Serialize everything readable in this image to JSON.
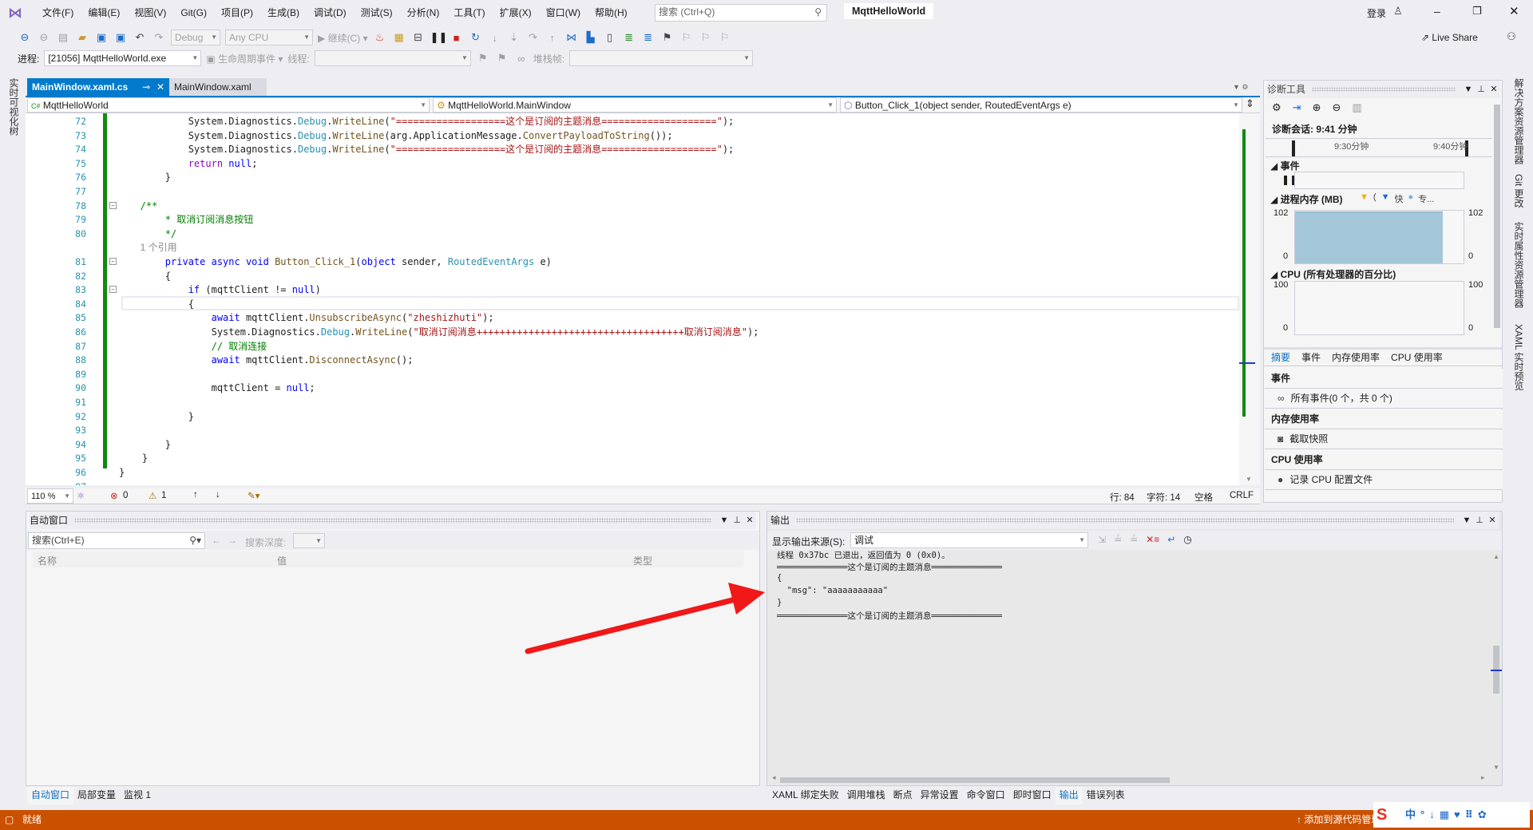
{
  "titlebar": {
    "menu": [
      "文件(F)",
      "编辑(E)",
      "视图(V)",
      "Git(G)",
      "项目(P)",
      "生成(B)",
      "调试(D)",
      "测试(S)",
      "分析(N)",
      "工具(T)",
      "扩展(X)",
      "窗口(W)",
      "帮助(H)"
    ],
    "search_placeholder": "搜索 (Ctrl+Q)",
    "solution_name": "MqttHelloWorld",
    "sign_in": "登录",
    "live_share": "Live Share"
  },
  "toolbar": {
    "config": "Debug",
    "platform": "Any CPU",
    "continue": "继续(C)",
    "process_label": "进程:",
    "process_value": "[21056] MqttHelloWorld.exe",
    "lifecycle": "生命周期事件",
    "thread_label": "线程:",
    "stack_label": "堆栈帧:"
  },
  "left_strip": {
    "label": "实时可视化树"
  },
  "right_strip": {
    "items": [
      "解决方案资源管理器",
      "Git 更改",
      "实时属性资源管理器",
      "XAML 实时预览"
    ]
  },
  "editor": {
    "tabs": [
      {
        "label": "MainWindow.xaml.cs",
        "active": true
      },
      {
        "label": "MainWindow.xaml",
        "active": false
      }
    ],
    "nav": {
      "project": "MqttHelloWorld",
      "type": "MqttHelloWorld.MainWindow",
      "member": "Button_Click_1(object sender, RoutedEventArgs e)"
    },
    "lines": [
      {
        "n": "72",
        "t": [
          [
            "n",
            "            System.Diagnostics."
          ],
          [
            "t",
            "Debug"
          ],
          [
            "n",
            "."
          ],
          [
            "m",
            "WriteLine"
          ],
          [
            "n",
            "("
          ],
          [
            "s",
            "\"===================这个是订阅的主题消息====================\""
          ],
          [
            "n",
            ");"
          ]
        ]
      },
      {
        "n": "73",
        "t": [
          [
            "n",
            "            System.Diagnostics."
          ],
          [
            "t",
            "Debug"
          ],
          [
            "n",
            "."
          ],
          [
            "m",
            "WriteLine"
          ],
          [
            "n",
            "(arg.ApplicationMessage."
          ],
          [
            "m",
            "ConvertPayloadToString"
          ],
          [
            "n",
            "());"
          ]
        ]
      },
      {
        "n": "74",
        "t": [
          [
            "n",
            "            System.Diagnostics."
          ],
          [
            "t",
            "Debug"
          ],
          [
            "n",
            "."
          ],
          [
            "m",
            "WriteLine"
          ],
          [
            "n",
            "("
          ],
          [
            "s",
            "\"===================这个是订阅的主题消息====================\""
          ],
          [
            "n",
            ");"
          ]
        ]
      },
      {
        "n": "75",
        "t": [
          [
            "p",
            "            return "
          ],
          [
            "k",
            "null"
          ],
          [
            "n",
            ";"
          ]
        ]
      },
      {
        "n": "76",
        "t": [
          [
            "n",
            "        }"
          ]
        ]
      },
      {
        "n": "77",
        "t": []
      },
      {
        "n": "78",
        "t": [
          [
            "g",
            "        "
          ],
          [
            "c",
            "/**"
          ]
        ]
      },
      {
        "n": "79",
        "t": [
          [
            "c",
            "        * 取消订阅消息按钮"
          ]
        ]
      },
      {
        "n": "80",
        "t": [
          [
            "c",
            "        */"
          ]
        ]
      },
      {
        "n": "",
        "t": [
          [
            "g",
            "        1 个引用"
          ]
        ]
      },
      {
        "n": "81",
        "t": [
          [
            "k",
            "        private async void "
          ],
          [
            "m",
            "Button_Click_1"
          ],
          [
            "n",
            "("
          ],
          [
            "k",
            "object"
          ],
          [
            "n",
            " sender, "
          ],
          [
            "t",
            "RoutedEventArgs"
          ],
          [
            "n",
            " e)"
          ]
        ]
      },
      {
        "n": "82",
        "t": [
          [
            "n",
            "        {"
          ]
        ]
      },
      {
        "n": "83",
        "t": [
          [
            "k",
            "            if"
          ],
          [
            "n",
            " (mqttClient != "
          ],
          [
            "k",
            "null"
          ],
          [
            "n",
            ")"
          ]
        ]
      },
      {
        "n": "84",
        "t": [
          [
            "n",
            "            {"
          ]
        ]
      },
      {
        "n": "85",
        "t": [
          [
            "k",
            "                await"
          ],
          [
            "n",
            " mqttClient."
          ],
          [
            "m",
            "UnsubscribeAsync"
          ],
          [
            "n",
            "("
          ],
          [
            "s",
            "\"zheshizhuti\""
          ],
          [
            "n",
            ");"
          ]
        ]
      },
      {
        "n": "86",
        "t": [
          [
            "n",
            "                System.Diagnostics."
          ],
          [
            "t",
            "Debug"
          ],
          [
            "n",
            "."
          ],
          [
            "m",
            "WriteLine"
          ],
          [
            "n",
            "("
          ],
          [
            "s",
            "\"取消订阅消息++++++++++++++++++++++++++++++++++++取消订阅消息\""
          ],
          [
            "n",
            ");"
          ]
        ]
      },
      {
        "n": "87",
        "t": [
          [
            "c",
            "                // 取消连接"
          ]
        ]
      },
      {
        "n": "88",
        "t": [
          [
            "k",
            "                await"
          ],
          [
            "n",
            " mqttClient."
          ],
          [
            "m",
            "DisconnectAsync"
          ],
          [
            "n",
            "();"
          ]
        ]
      },
      {
        "n": "89",
        "t": []
      },
      {
        "n": "90",
        "t": [
          [
            "n",
            "                mqttClient = "
          ],
          [
            "k",
            "null"
          ],
          [
            "n",
            ";"
          ]
        ]
      },
      {
        "n": "91",
        "t": []
      },
      {
        "n": "92",
        "t": [
          [
            "n",
            "            }"
          ]
        ]
      },
      {
        "n": "93",
        "t": []
      },
      {
        "n": "94",
        "t": [
          [
            "n",
            "        }"
          ]
        ]
      },
      {
        "n": "95",
        "t": [
          [
            "n",
            "    }"
          ]
        ]
      },
      {
        "n": "96",
        "t": [
          [
            "n",
            "}"
          ]
        ]
      },
      {
        "n": "97",
        "t": []
      }
    ],
    "status": {
      "zoom": "110 %",
      "errors": "0",
      "warnings": "1",
      "line": "行: 84",
      "char": "字符: 14",
      "indent": "空格",
      "eol": "CRLF"
    }
  },
  "diagnostics": {
    "title": "诊断工具",
    "session": "诊断会话: 9:41 分钟",
    "timeline_labels": [
      "9:30分钟",
      "9:40分钟"
    ],
    "events_label": "事件",
    "memory_label": "进程内存 (MB)",
    "memory_legend": [
      "(",
      "快",
      "专..."
    ],
    "memory_axis": {
      "max": "102",
      "min": "0"
    },
    "memory_level_mb": 100,
    "cpu_label": "CPU (所有处理器的百分比)",
    "cpu_axis": {
      "max": "100",
      "min": "0"
    },
    "tabs": [
      "摘要",
      "事件",
      "内存使用率",
      "CPU 使用率"
    ],
    "sections": [
      {
        "title": "事件",
        "item": "所有事件(0 个，共 0 个)",
        "icon": "events-icon"
      },
      {
        "title": "内存使用率",
        "item": "截取快照",
        "icon": "camera-icon"
      },
      {
        "title": "CPU 使用率",
        "item": "记录 CPU 配置文件",
        "icon": "record-icon"
      }
    ]
  },
  "autos": {
    "title": "自动窗口",
    "search_placeholder": "搜索(Ctrl+E)",
    "depth_label": "搜索深度:",
    "columns": [
      "名称",
      "值",
      "类型"
    ],
    "tabs": [
      "自动窗口",
      "局部变量",
      "监视 1"
    ]
  },
  "output": {
    "title": "输出",
    "source_label": "显示输出来源(S):",
    "source_value": "调试",
    "lines": [
      "线程 0x37bc 已退出，返回值为 0 (0x0)。",
      "══════════════这个是订阅的主题消息══════════════",
      "{",
      "  \"msg\": \"aaaaaaaaaaa\"",
      "}",
      "══════════════这个是订阅的主题消息══════════════"
    ],
    "tabs": [
      "XAML 绑定失败",
      "调用堆栈",
      "断点",
      "异常设置",
      "命令窗口",
      "即时窗口",
      "输出",
      "错误列表"
    ]
  },
  "statusbar": {
    "ready": "就绪",
    "source_control": "添加到源代码管理",
    "color": "#ca5100"
  },
  "colors": {
    "accent": "#007acc",
    "annotation_arrow": "#f01818"
  }
}
